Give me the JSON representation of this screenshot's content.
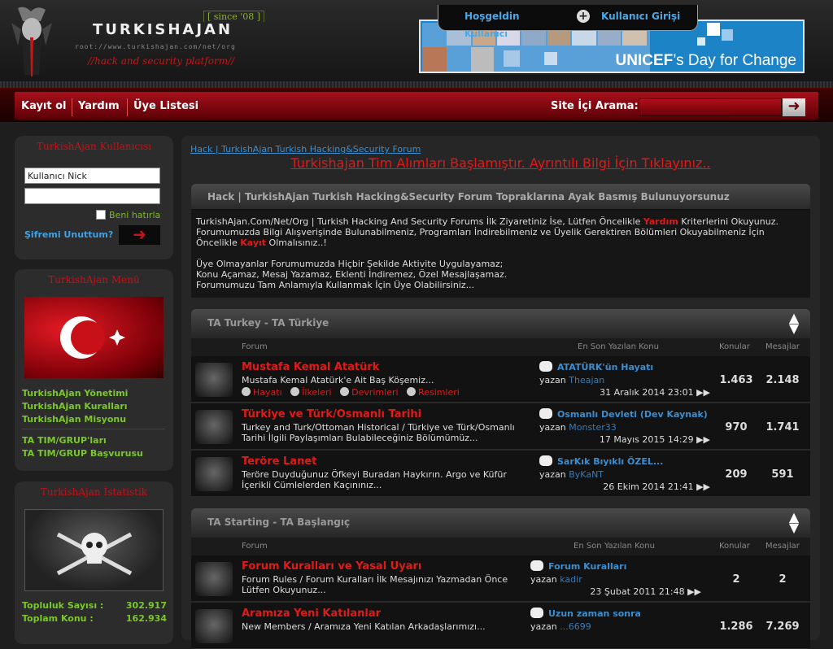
{
  "header": {
    "site_title": "TURKISHAJAN",
    "since": "[ since '08 ]",
    "url_text": "root://www.turkishajan.com/net/org",
    "tagline": "//hack and security platform//",
    "hello": "Hoşgeldin",
    "login": "Kullanıcı Girişi",
    "users_link": "Kullanıcı",
    "banner_text_brand": "UNICEF",
    "banner_text_rest": "’s Day for Change"
  },
  "nav": {
    "items": [
      "Kayıt ol",
      "Yardım",
      "Üye Listesi"
    ],
    "search_label": "Site İçi Arama:",
    "search_button": "➜"
  },
  "sidebar": {
    "user_box": {
      "title": "TurkishAjan Kullanıcısı",
      "username_value": "Kullanıcı Nick",
      "password_value": "",
      "remember": "Beni hatırla",
      "forgot": "Şifremi Unuttum?",
      "go": "➜"
    },
    "menu_box": {
      "title": "TurkishAjan Menü",
      "links": [
        "TurkishAjan Yönetimi",
        "TurkishAjan Kuralları",
        "TurkishAjan Misyonu",
        "TA TIM/GRUP'ları",
        "TA TIM/GRUP Başvurusu"
      ]
    },
    "stats_box": {
      "title": "TurkishAjan İstatistik",
      "stats": [
        {
          "label": "Topluluk Sayısı :",
          "value": "302.917"
        },
        {
          "label": "Toplam Konu     :",
          "value": "162.934"
        }
      ]
    }
  },
  "main": {
    "breadcrumb": "Hack | TurkishAjan Turkish Hacking&Security Forum",
    "announcement": "Turkishajan Tim Alımları Başlamıştır. Ayrıntılı Bilgi İçin Tıklayınız..",
    "welcome": {
      "title": "Hack | TurkishAjan Turkish Hacking&Security Forum Topraklarına Ayak Basmış Bulunuyorsunuz",
      "p1_a": "TurkishAjan.Com/Net/Org | Turkish Hacking And Security Forums İlk Ziyaretiniz İse, Lütfen Öncelikle ",
      "p1_help": "Yardım",
      "p1_b": " Kriterlerini Okuyunuz. Forumumuzda Bilgi Alışverişinde Bulunabilmeniz, Programları İndirebilmeniz ve Üyelik Gerektiren Bölümleri Okuyabilmeniz İçin Öncelikle ",
      "p1_reg": "Kayıt",
      "p1_c": " Olmalısınız..!",
      "p2_a": "Üye Olmayanlar Forumumuzda Hiçbir Şekilde Aktivite Uygulayamaz;",
      "p2_b": "Konu Açamaz, Mesaj Yazamaz, Eklenti İndiremez, Özel Mesajlaşamaz.",
      "p2_c": "Forumumuzu Tam Anlamıyla Kullanmak İçin Üye Olabilirsiniz..."
    },
    "columns": {
      "forum": "Forum",
      "last": "En Son Yazılan Konu",
      "topics": "Konular",
      "posts": "Mesajlar"
    },
    "categories": [
      {
        "title": "TA Turkey - TA Türkiye",
        "forums": [
          {
            "title": "Mustafa Kemal Atatürk",
            "desc": "Mustafa Kemal Atatürk'e Ait Baş Köşemiz...",
            "subs": [
              "Hayatı",
              "İlkeleri",
              "Devrimleri",
              "Resimleri"
            ],
            "last_title": "ATATÜRK'ün Hayatı",
            "by": "yazan",
            "author": "Theajan",
            "date": "31 Aralık 2014 23:01 ▶▶",
            "topics": "1.463",
            "posts": "2.148"
          },
          {
            "title": "Türkiye ve Türk/Osmanlı Tarihi",
            "desc": "Turkey and Turk/Ottoman Historical / Türkiye ve Türk/Osmanlı Tarihi İlgili Paylaşımları Bulabileceğiniz Bölümümüz...",
            "subs": [],
            "last_title": "Osmanlı Devleti (Dev Kaynak)",
            "by": "yazan",
            "author": "Monster33",
            "date": "17 Mayıs 2015 14:29 ▶▶",
            "topics": "970",
            "posts": "1.741"
          },
          {
            "title": "Teröre Lanet",
            "desc": "Teröre Duyduğunuz Öfkeyi Buradan Haykırın. Argo ve Küfür İçerikli Cümlelerden Kaçınınız...",
            "subs": [],
            "last_title": "SarKık Bıyıklı ÖZEL...",
            "by": "yazan",
            "author": "ByKaNT",
            "date": "26 Ekim 2014 21:41 ▶▶",
            "topics": "209",
            "posts": "591"
          }
        ]
      },
      {
        "title": "TA Starting - TA Başlangıç",
        "forums": [
          {
            "title": "Forum Kuralları ve Yasal Uyarı",
            "desc": "Forum Rules / Forum Kuralları İlk Mesajınızı Yazmadan Önce Lütfen Okuyunuz...",
            "subs": [],
            "last_title": "Forum Kuralları",
            "by": "yazan",
            "author": "kadir",
            "date": "23 Şubat 2011 21:48 ▶▶",
            "topics": "2",
            "posts": "2"
          },
          {
            "title": "Aramıza Yeni Katılanlar",
            "desc": "New Members / Aramıza Yeni Katılan Arkadaşlarımızı...",
            "subs": [],
            "last_title": "Uzun zaman sonra",
            "by": "yazan",
            "author": "...6699",
            "date": "",
            "topics": "1.286",
            "posts": "7.269"
          }
        ]
      }
    ]
  },
  "colors": {
    "accent_red": "#e01a1a",
    "link_blue": "#3b8ed0",
    "menu_green": "#7ac82a",
    "nav_red": "#a8101a"
  }
}
